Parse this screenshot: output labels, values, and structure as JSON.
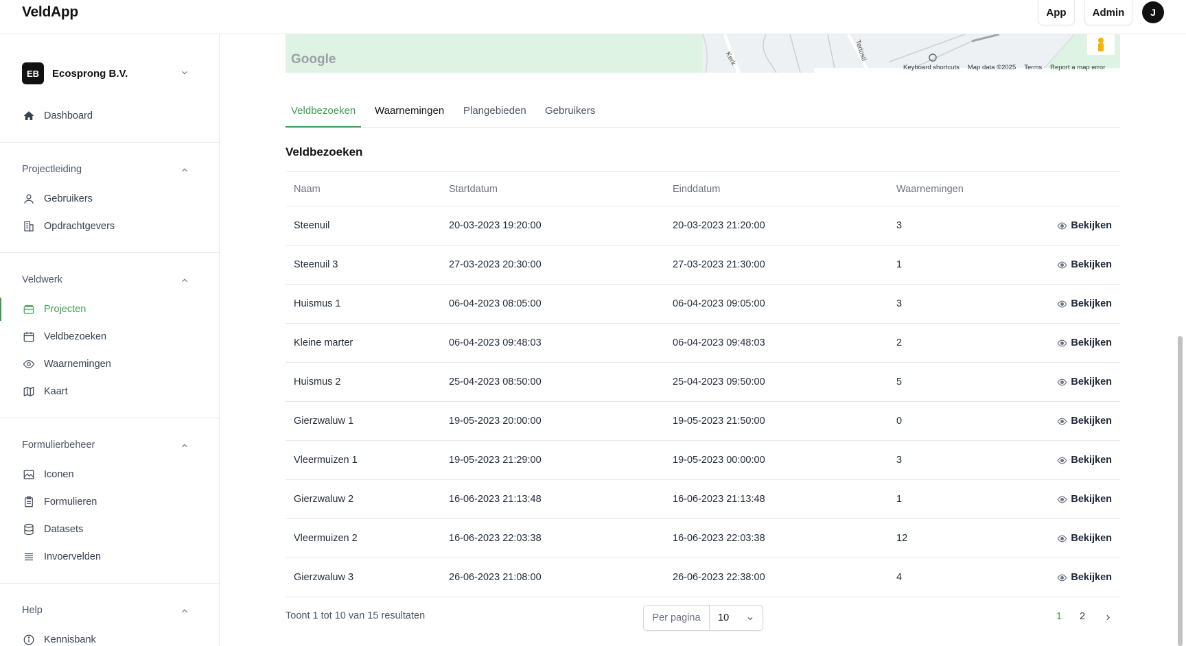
{
  "app": {
    "brand": "VeldApp"
  },
  "header": {
    "app_button": "App",
    "admin_button": "Admin",
    "avatar_initial": "J"
  },
  "sidebar": {
    "org": {
      "initials": "EB",
      "name": "Ecosprong B.V."
    },
    "dashboard": "Dashboard",
    "sections": [
      {
        "title": "Projectleiding",
        "items": [
          "Gebruikers",
          "Opdrachtgevers"
        ]
      },
      {
        "title": "Veldwerk",
        "items": [
          "Projecten",
          "Veldbezoeken",
          "Waarnemingen",
          "Kaart"
        ]
      },
      {
        "title": "Formulierbeheer",
        "items": [
          "Iconen",
          "Formulieren",
          "Datasets",
          "Invoervelden"
        ]
      },
      {
        "title": "Help",
        "items": [
          "Kennisbank"
        ]
      }
    ],
    "active_item": "Projecten"
  },
  "map": {
    "attribution": [
      "Keyboard shortcuts",
      "Map data ©2025",
      "Terms",
      "Report a map error"
    ],
    "google_logo": "Google",
    "street_labels": [
      "Kerk",
      "Terlosti"
    ]
  },
  "tabs": [
    "Veldbezoeken",
    "Waarnemingen",
    "Plangebieden",
    "Gebruikers"
  ],
  "active_tab": "Veldbezoeken",
  "card_title": "Veldbezoeken",
  "table": {
    "columns": [
      "Naam",
      "Startdatum",
      "Einddatum",
      "Waarnemingen"
    ],
    "action_label": "Bekijken",
    "rows": [
      {
        "naam": "Steenuil",
        "start": "20-03-2023 19:20:00",
        "eind": "20-03-2023 21:20:00",
        "waarnemingen": "3"
      },
      {
        "naam": "Steenuil 3",
        "start": "27-03-2023 20:30:00",
        "eind": "27-03-2023 21:30:00",
        "waarnemingen": "1"
      },
      {
        "naam": "Huismus 1",
        "start": "06-04-2023 08:05:00",
        "eind": "06-04-2023 09:05:00",
        "waarnemingen": "3"
      },
      {
        "naam": "Kleine marter",
        "start": "06-04-2023 09:48:03",
        "eind": "06-04-2023 09:48:03",
        "waarnemingen": "2"
      },
      {
        "naam": "Huismus 2",
        "start": "25-04-2023 08:50:00",
        "eind": "25-04-2023 09:50:00",
        "waarnemingen": "5"
      },
      {
        "naam": "Gierzwaluw 1",
        "start": "19-05-2023 20:00:00",
        "eind": "19-05-2023 21:50:00",
        "waarnemingen": "0"
      },
      {
        "naam": "Vleermuizen 1",
        "start": "19-05-2023 21:29:00",
        "eind": "19-05-2023 00:00:00",
        "waarnemingen": "3"
      },
      {
        "naam": "Gierzwaluw 2",
        "start": "16-06-2023 21:13:48",
        "eind": "16-06-2023 21:13:48",
        "waarnemingen": "1"
      },
      {
        "naam": "Vleermuizen 2",
        "start": "16-06-2023 22:03:38",
        "eind": "16-06-2023 22:03:38",
        "waarnemingen": "12"
      },
      {
        "naam": "Gierzwaluw 3",
        "start": "26-06-2023 21:08:00",
        "eind": "26-06-2023 22:38:00",
        "waarnemingen": "4"
      }
    ]
  },
  "pagination": {
    "summary": "Toont 1 tot 10 van 15 resultaten",
    "per_page_label": "Per pagina",
    "per_page_value": "10",
    "pages": [
      "1",
      "2"
    ],
    "current_page": "1"
  },
  "colors": {
    "accent": "#3f9d52",
    "border": "#e5e7eb",
    "map_green": "#dff3e4"
  }
}
